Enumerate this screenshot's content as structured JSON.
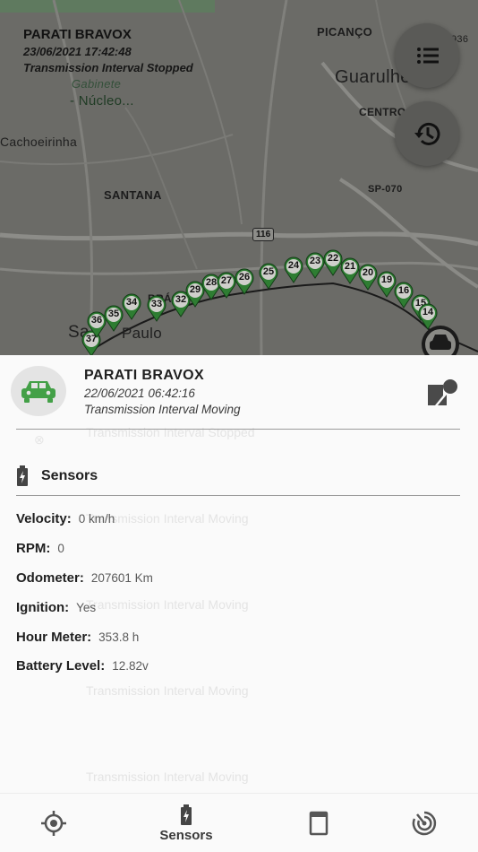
{
  "map": {
    "labels": {
      "picanco": "PICANÇO",
      "guarulhos": "Guarulhe",
      "centro": "CENTRO",
      "cachoeirinha": "Cachoeirinha",
      "santana": "SANTANA",
      "sp070": "SP-070",
      "nucleo": "- Núcleo...",
      "nucleo_top": "Gabinete",
      "route116": "116",
      "sao_paulo_a": "Sa",
      "sao_paulo_b": "Paulo",
      "bras": "BRÁS",
      "edge_num": "936"
    },
    "info": {
      "vehicle": "PARATI BRAVOX",
      "datetime": "23/06/2021 17:42:48",
      "status": "Transmission Interval Stopped"
    },
    "markers": [
      "37",
      "36",
      "35",
      "34",
      "33",
      "32",
      "29",
      "28",
      "27",
      "26",
      "25",
      "24",
      "23",
      "22",
      "21",
      "20",
      "19",
      "16",
      "15",
      "14"
    ],
    "colors": {
      "marker": "#2e7d32",
      "route": "#1a1a1a"
    }
  },
  "vehicle": {
    "name": "PARATI BRAVOX",
    "datetime": "22/06/2021 06:42:16",
    "status": "Transmission Interval Moving",
    "icon": "car-icon",
    "accent": "#43a047"
  },
  "sensors": {
    "title": "Sensors",
    "rows": [
      {
        "label": "Velocity:",
        "value": "0 km/h"
      },
      {
        "label": "RPM:",
        "value": "0"
      },
      {
        "label": "Odometer:",
        "value": "207601 Km"
      },
      {
        "label": "Ignition:",
        "value": "Yes"
      },
      {
        "label": "Hour Meter:",
        "value": "353.8 h"
      },
      {
        "label": "Battery Level:",
        "value": "12.82v"
      }
    ]
  },
  "ghost_list": [
    "Transmission Interval Stopped",
    "Transmission Interval Moving",
    "Transmission Interval Moving",
    "Transmission Interval Moving",
    "Transmission Interval Moving"
  ],
  "nav": {
    "items": [
      {
        "icon": "target-icon",
        "label": ""
      },
      {
        "icon": "battery-icon",
        "label": "Sensors"
      },
      {
        "icon": "device-icon",
        "label": ""
      },
      {
        "icon": "radar-icon",
        "label": ""
      }
    ]
  }
}
